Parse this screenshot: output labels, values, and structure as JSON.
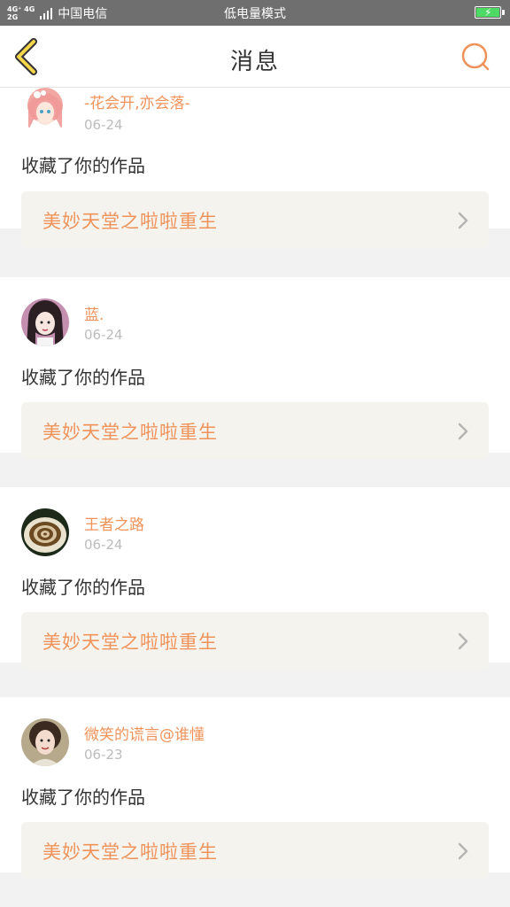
{
  "status_bar": {
    "network_top": "4G⁺ 4G",
    "network_bottom": "2G",
    "carrier": "中国电信",
    "mode": "低电量模式"
  },
  "header": {
    "title": "消息",
    "back_icon": "back-chevron-icon",
    "search_icon": "search-icon"
  },
  "messages": [
    {
      "username": "-花会开,亦会落-",
      "date": "06-24",
      "action": "收藏了你的作品",
      "work_title": "美妙天堂之啦啦重生",
      "avatar": "anime-girl-pink-hair"
    },
    {
      "username": "蓝.",
      "date": "06-24",
      "action": "收藏了你的作品",
      "work_title": "美妙天堂之啦啦重生",
      "avatar": "girl-dark-hair"
    },
    {
      "username": "王者之路",
      "date": "06-24",
      "action": "收藏了你的作品",
      "work_title": "美妙天堂之啦啦重生",
      "avatar": "coffee-cup"
    },
    {
      "username": "微笑的谎言@谁懂",
      "date": "06-23",
      "action": "收藏了你的作品",
      "work_title": "美妙天堂之啦啦重生",
      "avatar": "woman-portrait"
    }
  ],
  "colors": {
    "accent": "#f0935a",
    "status_bar": "#6f6f6f",
    "battery": "#4cd964",
    "card_inner": "#f4f3ee"
  }
}
